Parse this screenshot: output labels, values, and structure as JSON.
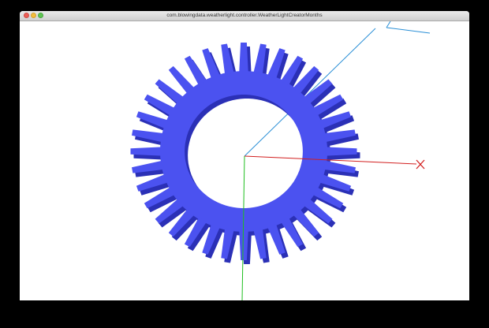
{
  "window": {
    "title": "com.blowingdata.weatherlight.controller.WeatherLightCreatorMonths"
  },
  "scene": {
    "background_color": "#ffffff",
    "gear_color": "#4b52f0",
    "gear_shadow_color": "#2b30b6",
    "axis_colors": {
      "x": "#d21f1f",
      "y": "#1fbf1f",
      "z": "#2a8fd6"
    },
    "gear_tooth_count": 36
  }
}
